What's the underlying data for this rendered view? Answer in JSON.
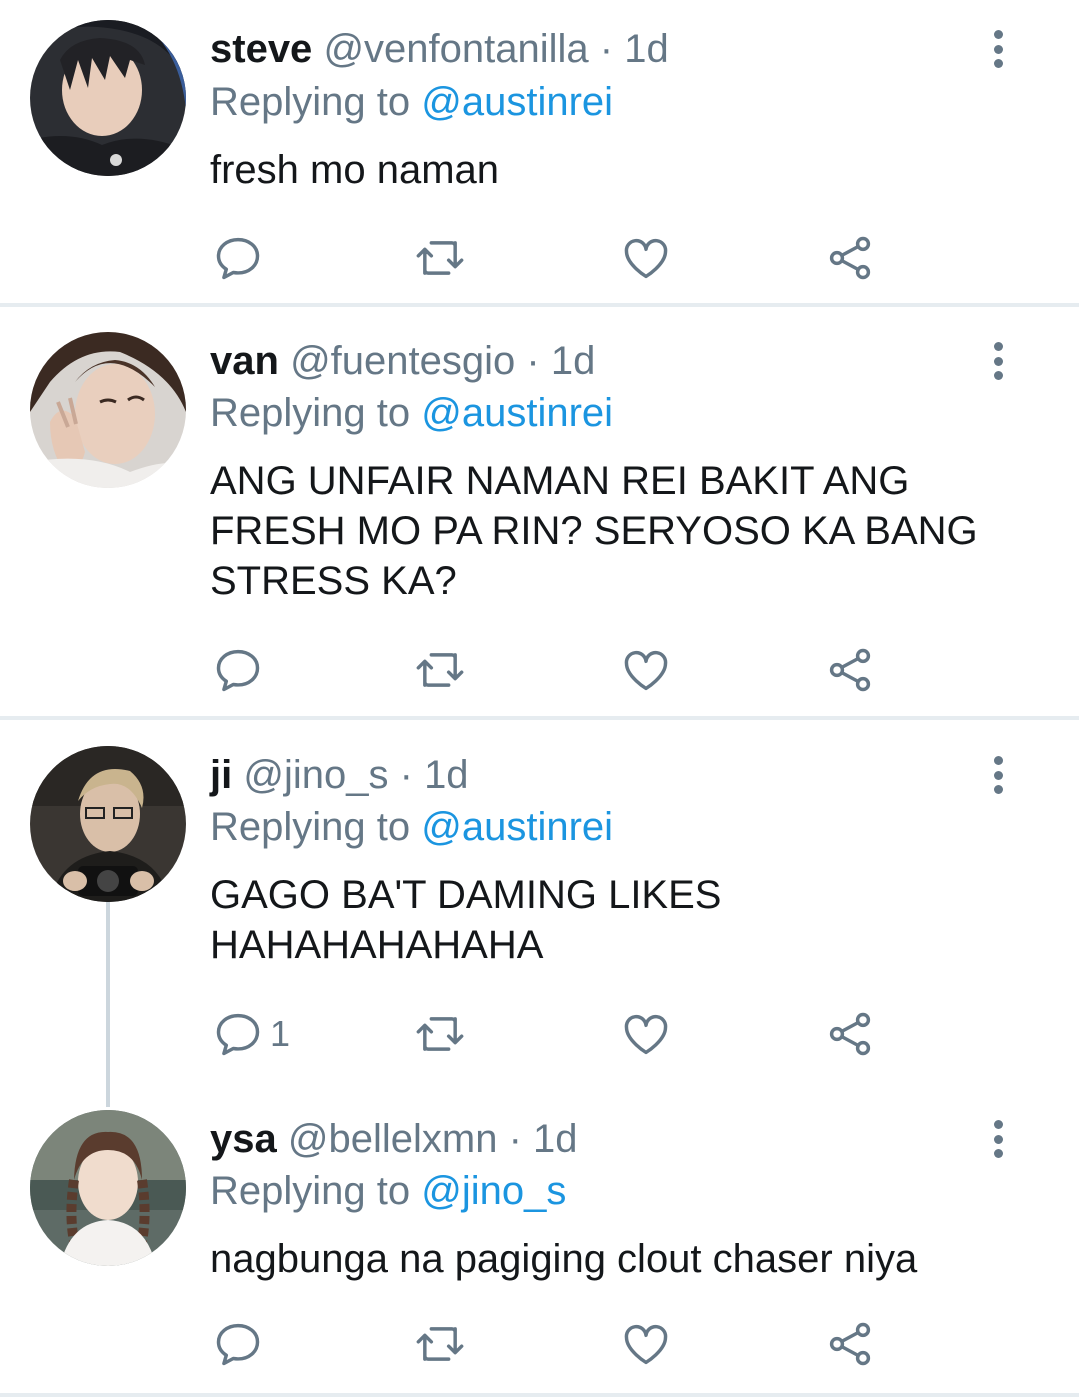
{
  "tweets": [
    {
      "name": "steve",
      "handle": "@venfontanilla",
      "separator": "·",
      "time": "1d",
      "replying_prefix": "Replying to",
      "replying_to": "@austinrei",
      "text": "fresh mo naman",
      "reply_count": ""
    },
    {
      "name": "van",
      "handle": "@fuentesgio",
      "separator": "·",
      "time": "1d",
      "replying_prefix": "Replying to",
      "replying_to": "@austinrei",
      "text": "ANG UNFAIR NAMAN REI BAKIT ANG\nFRESH MO PA RIN? SERYOSO KA BANG\nSTRESS KA?",
      "reply_count": ""
    },
    {
      "name": "ji",
      "handle": "@jino_s",
      "separator": "·",
      "time": "1d",
      "replying_prefix": "Replying to",
      "replying_to": "@austinrei",
      "text": "GAGO BA'T DAMING LIKES\nHAHAHAHAHAHA",
      "reply_count": "1"
    },
    {
      "name": "ysa",
      "handle": "@bellelxmn",
      "separator": "·",
      "time": "1d",
      "replying_prefix": "Replying to",
      "replying_to": "@jino_s",
      "text": "nagbunga na pagiging clout chaser niya",
      "reply_count": ""
    }
  ],
  "icons": {
    "reply": "reply-icon",
    "retweet": "retweet-icon",
    "like": "heart-icon",
    "share": "share-icon",
    "more": "more-vertical-icon"
  },
  "colors": {
    "text": "#14171a",
    "secondary": "#657786",
    "link": "#1b95e0",
    "divider": "#e6ecf0"
  }
}
